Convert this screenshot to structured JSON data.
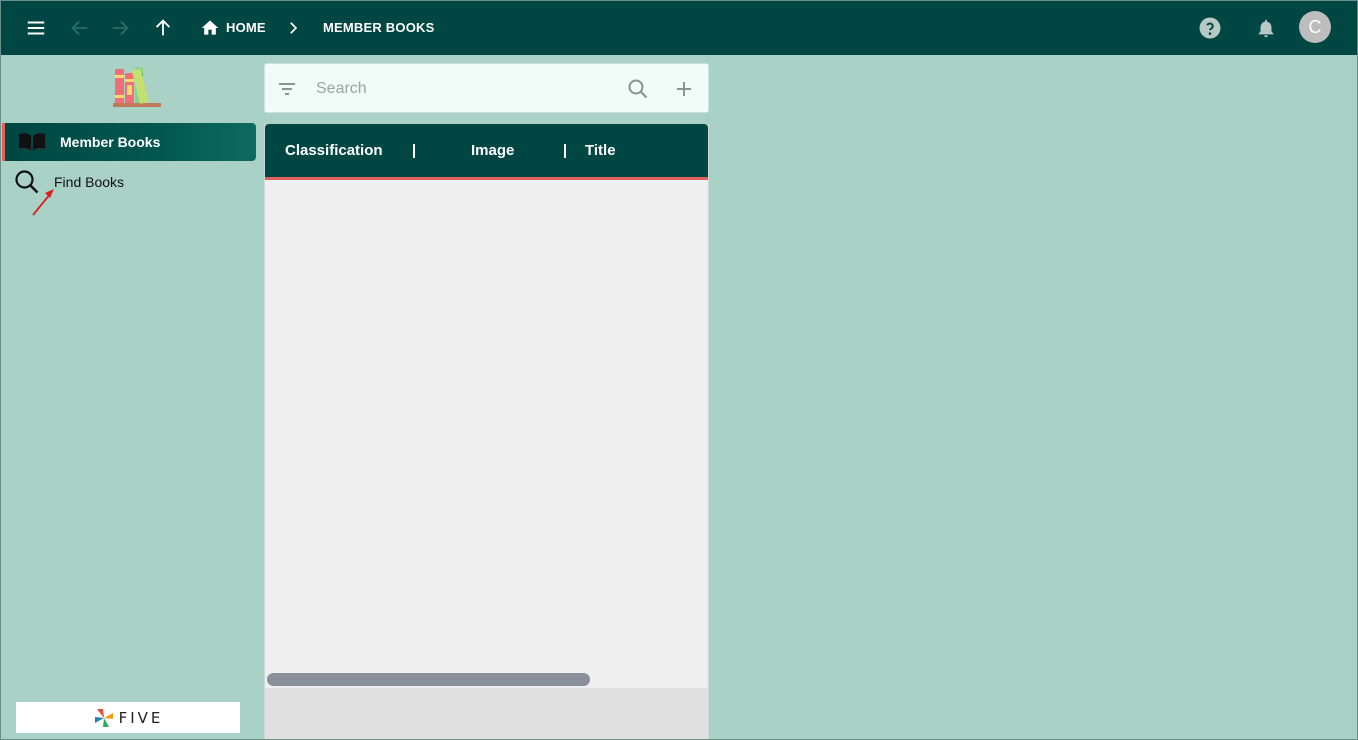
{
  "topbar": {
    "breadcrumb_home": "HOME",
    "breadcrumb_current": "MEMBER BOOKS",
    "avatar_initial": "C"
  },
  "sidebar": {
    "items": [
      {
        "label": "Member Books",
        "icon": "open-book-icon",
        "active": true
      },
      {
        "label": "Find Books",
        "icon": "search-icon",
        "active": false
      }
    ],
    "footer_logo_text": "FIVE"
  },
  "list": {
    "search_placeholder": "Search",
    "columns": [
      "Classification",
      "Image",
      "Title"
    ]
  },
  "colors": {
    "topbar": "#004643",
    "background": "#aad1c6",
    "accent": "#e0615b"
  }
}
